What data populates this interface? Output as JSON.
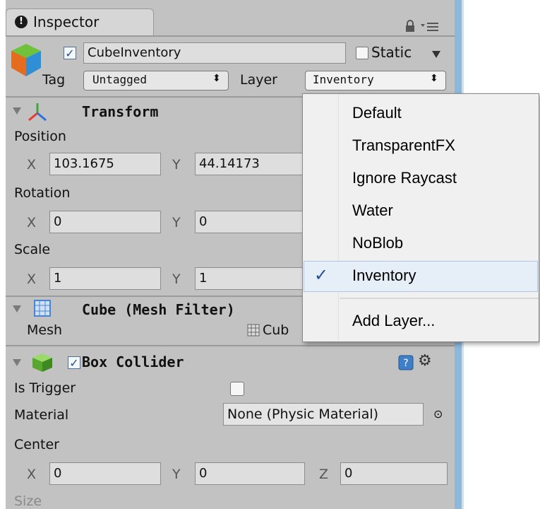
{
  "inspector": {
    "tab_label": "Inspector",
    "tab_icon": "info-icon",
    "lock_icon": "lock-icon",
    "menu_icon": "context-menu-icon"
  },
  "object": {
    "active": true,
    "name": "CubeInventory",
    "static_label": "Static",
    "static_checked": false,
    "tag_label": "Tag",
    "tag_value": "Untagged",
    "layer_label": "Layer",
    "layer_value": "Inventory"
  },
  "transform": {
    "title": "Transform",
    "position_label": "Position",
    "position": {
      "x": "103.1675",
      "y": "44.14173"
    },
    "rotation_label": "Rotation",
    "rotation": {
      "x": "0",
      "y": "0"
    },
    "scale_label": "Scale",
    "scale": {
      "x": "1",
      "y": "1"
    },
    "x_label": "X",
    "y_label": "Y"
  },
  "mesh_filter": {
    "title": "Cube (Mesh Filter)",
    "mesh_label": "Mesh",
    "mesh_value": "Cub"
  },
  "box_collider": {
    "title": "Box Collider",
    "enabled": true,
    "is_trigger_label": "Is Trigger",
    "is_trigger": false,
    "material_label": "Material",
    "material_value": "None (Physic Material)",
    "center_label": "Center",
    "center": {
      "x": "0",
      "y": "0",
      "z": "0"
    },
    "size_label": "Size",
    "x_label": "X",
    "y_label": "Y",
    "z_label": "Z"
  },
  "layer_dropdown": {
    "items": [
      "Default",
      "TransparentFX",
      "Ignore Raycast",
      "Water",
      "NoBlob",
      "Inventory"
    ],
    "selected": "Inventory",
    "check_glyph": "✓",
    "add_layer": "Add Layer..."
  },
  "colors": {
    "panel_bg": "#c2c2c2",
    "dropdown_bg": "#f0f0f0",
    "selection": "#e6eef8",
    "check_color": "#254e92"
  }
}
